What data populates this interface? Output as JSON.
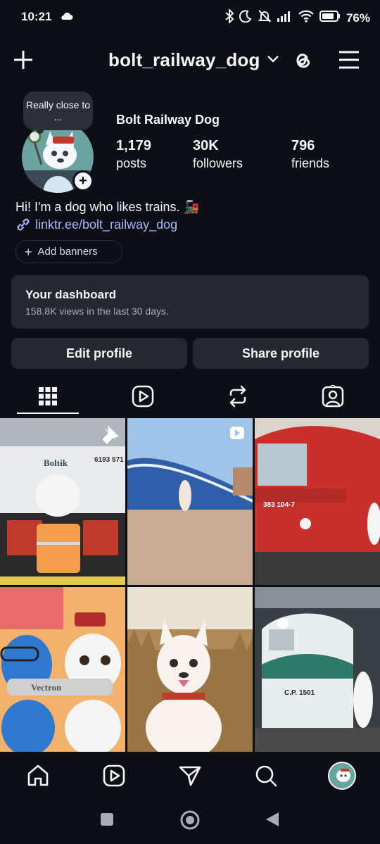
{
  "status": {
    "time": "10:21",
    "battery": "76"
  },
  "header": {
    "username": "bolt_railway_dog",
    "icons": [
      "plus-icon",
      "chevron-down-icon",
      "threads-icon",
      "menu-icon"
    ]
  },
  "profile": {
    "note": "Really close to ...",
    "display_name": "Bolt Railway Dog",
    "stats": [
      {
        "value": "1,179",
        "label": "posts"
      },
      {
        "value": "30K",
        "label": "followers"
      },
      {
        "value": "796",
        "label": "friends"
      }
    ],
    "bio": "Hi! I'm a dog who likes trains. 🚂",
    "link": "linktr.ee/bolt_railway_dog",
    "add_banners": "Add banners"
  },
  "dashboard": {
    "title": "Your dashboard",
    "subtitle": "158.8K views in the last 30 days."
  },
  "buttons": {
    "edit": "Edit profile",
    "share": "Share profile"
  },
  "tabs": [
    "grid-icon",
    "reels-icon",
    "reposts-icon",
    "tagged-icon"
  ],
  "grid": {
    "cells": [
      {
        "label": "Boltik",
        "number": "6193 571",
        "pinned": true
      },
      {
        "reel": true
      },
      {
        "number": "383 104-7"
      },
      {
        "label": "Vectron"
      },
      {},
      {
        "number": "C.P. 1501"
      }
    ]
  },
  "colors": {
    "background": "#0c0f14",
    "surface": "#25292e",
    "link": "#a6b7ff"
  }
}
